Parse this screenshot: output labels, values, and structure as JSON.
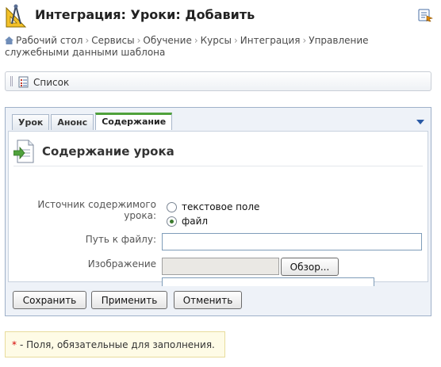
{
  "header": {
    "title": "Интеграция: Уроки: Добавить",
    "logo_icon": "compass-ruler-icon",
    "help_icon": "help-book-icon"
  },
  "breadcrumb": {
    "items": [
      "Рабочий стол",
      "Сервисы",
      "Обучение",
      "Курсы",
      "Интеграция",
      "Управление служебными данными шаблона"
    ],
    "separator": "›"
  },
  "toolbar": {
    "list_label": "Список"
  },
  "tabs": [
    {
      "label": "Урок",
      "active": false
    },
    {
      "label": "Анонс",
      "active": false
    },
    {
      "label": "Содержание",
      "active": true
    }
  ],
  "section": {
    "title": "Содержание урока"
  },
  "form": {
    "source_label": "Источник содержимого урока:",
    "source_options": [
      {
        "label": "текстовое поле",
        "checked": false
      },
      {
        "label": "файл",
        "checked": true
      }
    ],
    "path_label": "Путь к файлу:",
    "path_value": "",
    "image_label": "Изображение",
    "browse_label": "Обзор...",
    "image_value": ""
  },
  "actions": {
    "save": "Сохранить",
    "apply": "Применить",
    "cancel": "Отменить"
  },
  "note": {
    "star": "*",
    "text": "- Поля, обязательные для заполнения."
  },
  "colors": {
    "active_tab_accent": "#4fa13b",
    "panel_border": "#9fb1c9",
    "note_background": "#fefbe6"
  }
}
